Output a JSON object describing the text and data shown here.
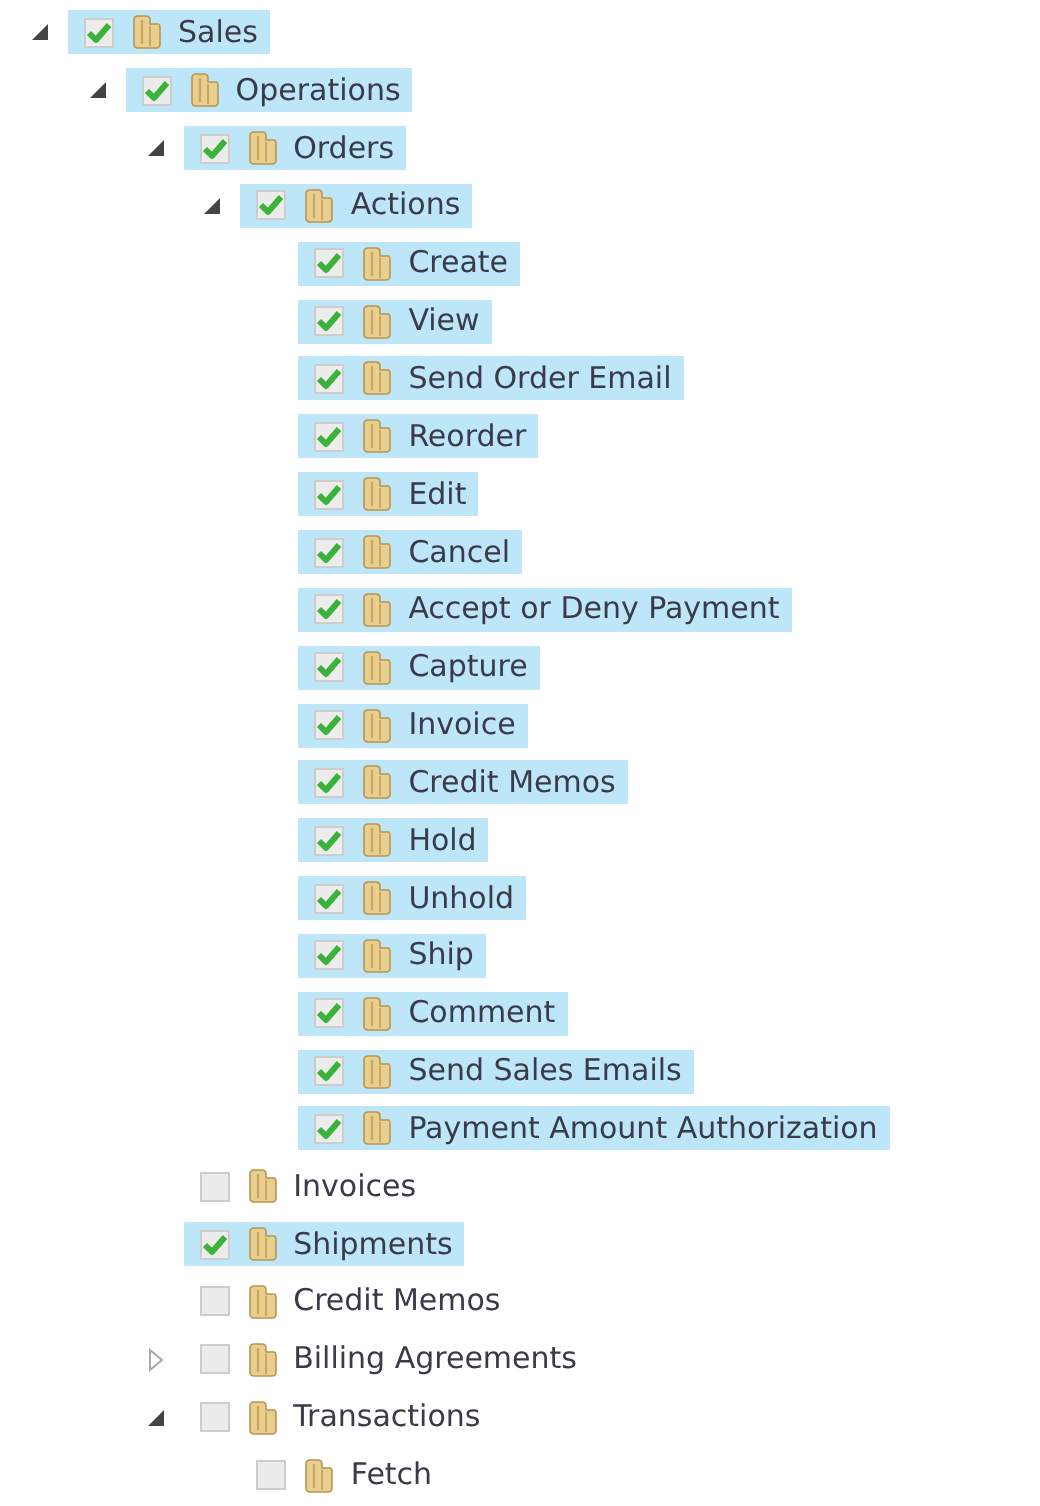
{
  "tree": [
    {
      "label": "Sales",
      "checked": true,
      "expanded": true,
      "children": [
        {
          "label": "Operations",
          "checked": true,
          "expanded": true,
          "children": [
            {
              "label": "Orders",
              "checked": true,
              "expanded": true,
              "children": [
                {
                  "label": "Actions",
                  "checked": true,
                  "expanded": true,
                  "children": [
                    {
                      "label": "Create",
                      "checked": true
                    },
                    {
                      "label": "View",
                      "checked": true
                    },
                    {
                      "label": "Send Order Email",
                      "checked": true
                    },
                    {
                      "label": "Reorder",
                      "checked": true
                    },
                    {
                      "label": "Edit",
                      "checked": true
                    },
                    {
                      "label": "Cancel",
                      "checked": true
                    },
                    {
                      "label": "Accept or Deny Payment",
                      "checked": true
                    },
                    {
                      "label": "Capture",
                      "checked": true
                    },
                    {
                      "label": "Invoice",
                      "checked": true
                    },
                    {
                      "label": "Credit Memos",
                      "checked": true
                    },
                    {
                      "label": "Hold",
                      "checked": true
                    },
                    {
                      "label": "Unhold",
                      "checked": true
                    },
                    {
                      "label": "Ship",
                      "checked": true
                    },
                    {
                      "label": "Comment",
                      "checked": true
                    },
                    {
                      "label": "Send Sales Emails",
                      "checked": true
                    },
                    {
                      "label": "Payment Amount Authorization",
                      "checked": true
                    }
                  ]
                }
              ]
            },
            {
              "label": "Invoices",
              "checked": false
            },
            {
              "label": "Shipments",
              "checked": true
            },
            {
              "label": "Credit Memos",
              "checked": false
            },
            {
              "label": "Billing Agreements",
              "checked": false,
              "expanded": false
            },
            {
              "label": "Transactions",
              "checked": false,
              "expanded": true,
              "children": [
                {
                  "label": "Fetch",
                  "checked": false
                }
              ]
            }
          ]
        }
      ]
    }
  ]
}
